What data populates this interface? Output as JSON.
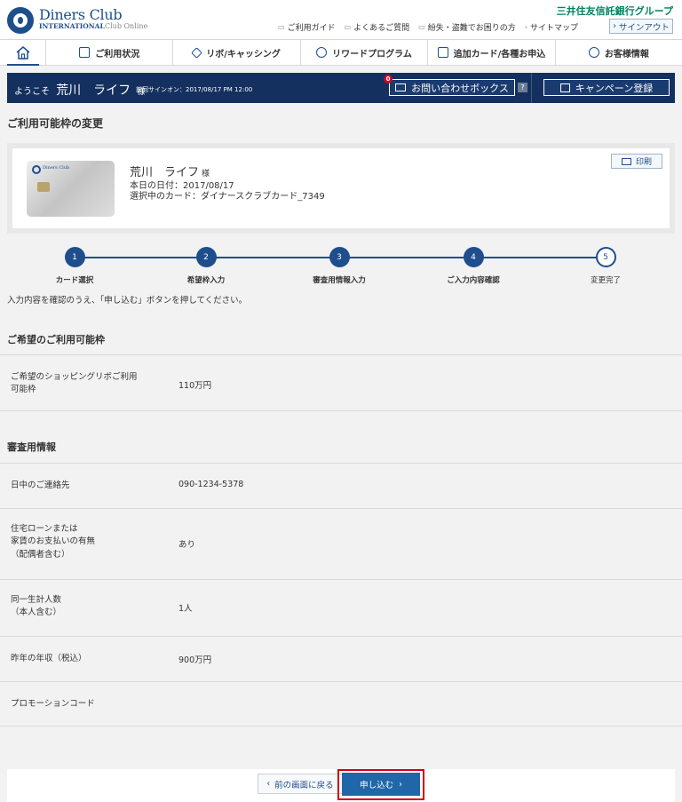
{
  "header": {
    "brand": "Diners Club",
    "brand_sub": "INTERNATIONAL",
    "brand_online": "Club Online",
    "group": "三井住友信託銀行グループ",
    "links": [
      "ご利用ガイド",
      "よくあるご質問",
      "紛失・盗難でお困りの方",
      "サイトマップ"
    ],
    "signout": "サインアウト"
  },
  "nav": {
    "items": [
      "ご利用状況",
      "リボ/キャッシング",
      "リワードプログラム",
      "追加カード/各種お申込",
      "お客様情報"
    ]
  },
  "welcome": {
    "greeting": "ようこそ",
    "name": "荒川　ライフ",
    "sama": "様",
    "last_signin": "前回サインオン：2017/08/17 PM 12:00",
    "inquiry_count": "0",
    "inquiry": "お問い合わせボックス",
    "help": "?",
    "campaign": "キャンペーン登録"
  },
  "page": {
    "title": "ご利用可能枠の変更"
  },
  "card": {
    "name": "荒川　ライフ",
    "sama": "様",
    "date": "本日の日付：2017/08/17",
    "selected": "選択中のカード：ダイナースクラブカード_7349",
    "print": "印刷",
    "logo_text": "Diners Club"
  },
  "steps": [
    {
      "num": "1",
      "label": "カード選択"
    },
    {
      "num": "2",
      "label": "希望枠入力"
    },
    {
      "num": "3",
      "label": "審査用情報入力"
    },
    {
      "num": "4",
      "label": "ご入力内容確認"
    },
    {
      "num": "5",
      "label": "変更完了"
    }
  ],
  "instruction": "入力内容を確認のうえ、「申し込む」ボタンを押してください。",
  "section1": {
    "title": "ご希望のご利用可能枠",
    "rows": [
      {
        "label_1": "ご希望のショッピングリボご利用",
        "label_2": "可能枠",
        "value": "110万円"
      }
    ]
  },
  "section2": {
    "title": "審査用情報",
    "rows": [
      {
        "label_1": "日中のご連絡先",
        "value": "090-1234-5378"
      },
      {
        "label_1": "住宅ローンまたは",
        "label_2": "家賃のお支払いの有無",
        "label_3": "（配偶者含む）",
        "value": "あり"
      },
      {
        "label_1": "同一生計人数",
        "label_2": "（本人含む）",
        "value": "1人"
      },
      {
        "label_1": "昨年の年収（税込）",
        "value": "900万円"
      },
      {
        "label_1": "プロモーションコード",
        "value": ""
      }
    ]
  },
  "buttons": {
    "back": "前の画面に戻る",
    "apply": "申し込む"
  }
}
